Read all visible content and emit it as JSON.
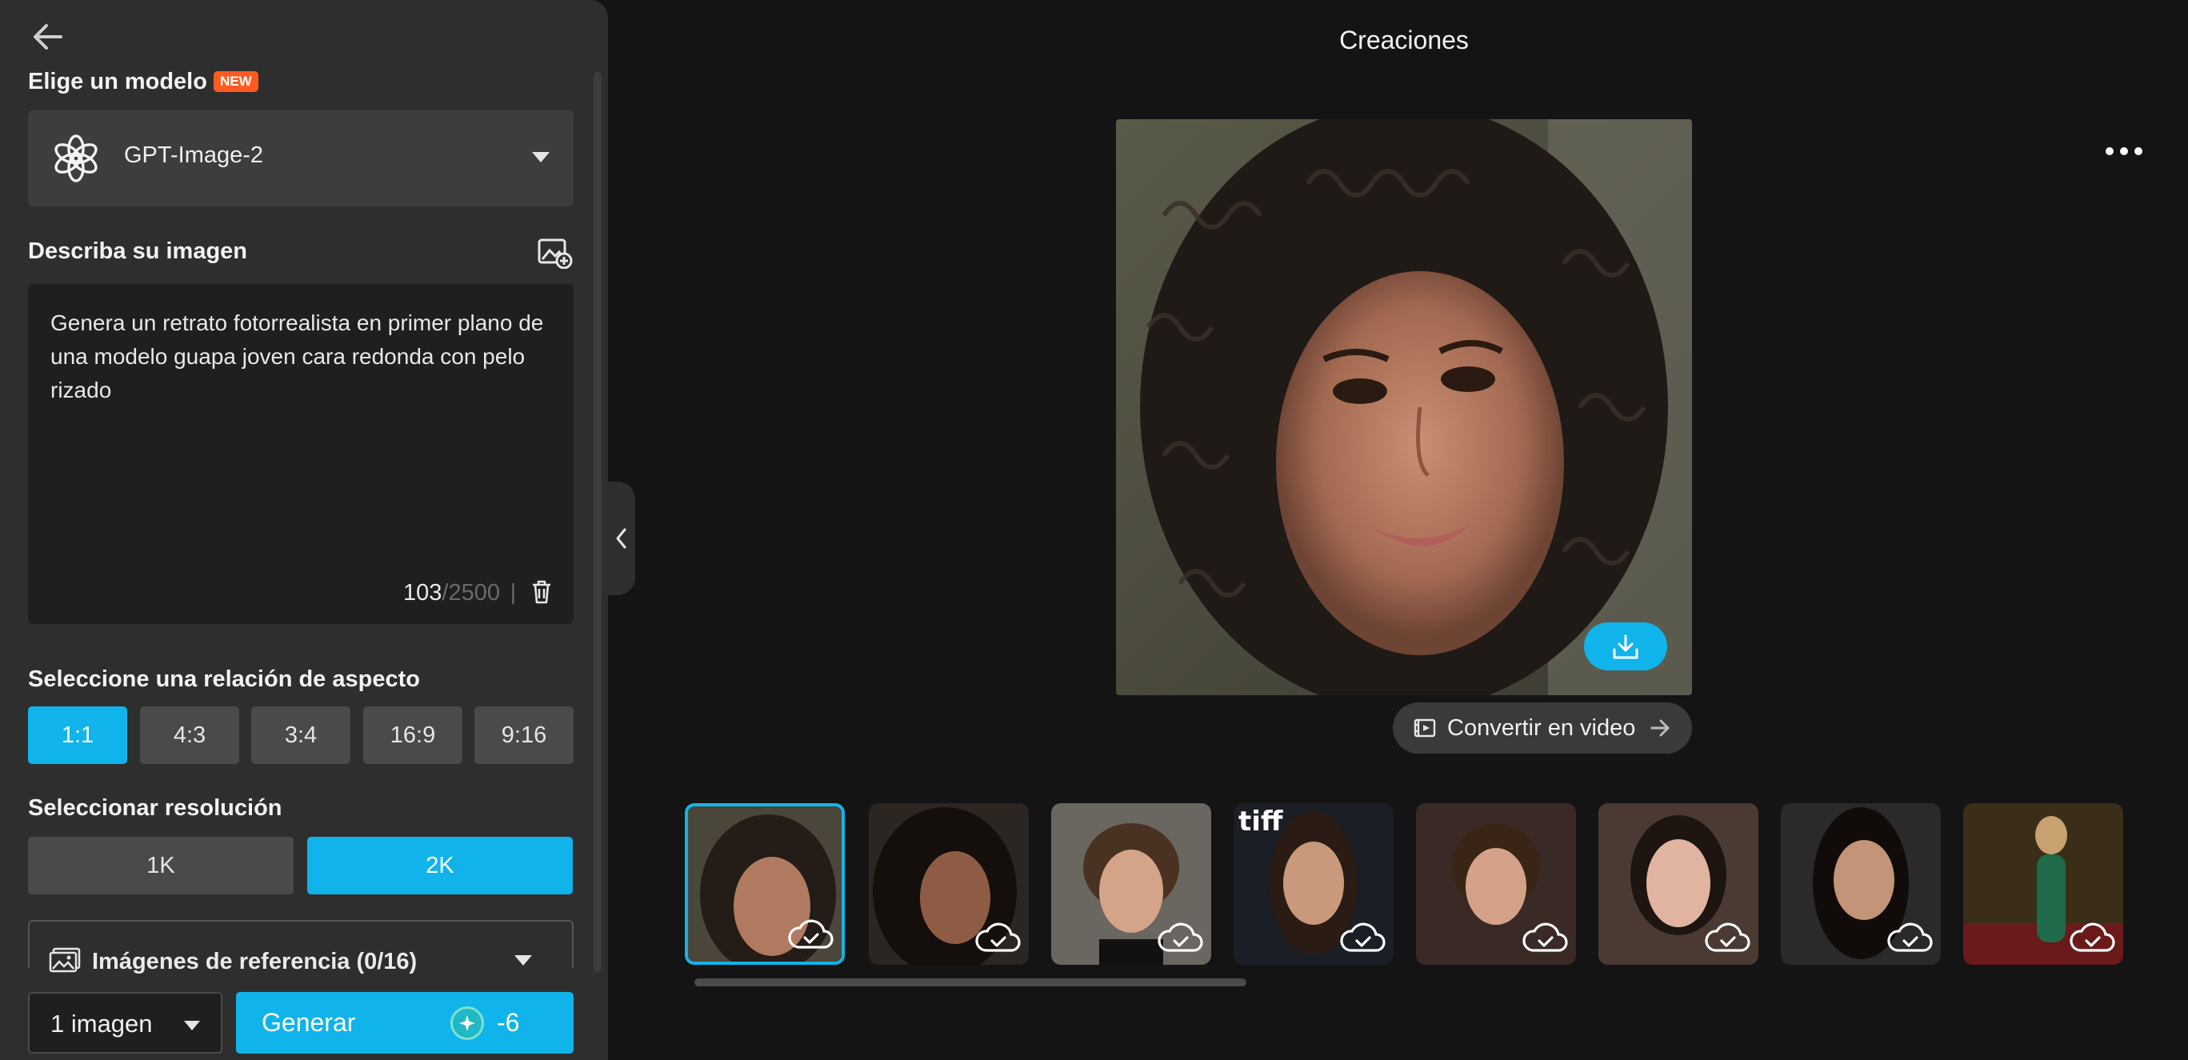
{
  "panel": {
    "model_section_title": "Elige un modelo",
    "model_badge": "NEW",
    "model_name": "GPT-Image-2",
    "prompt_section_title": "Describa su imagen",
    "prompt_text": "Genera un retrato fotorrealista en primer plano de una modelo guapa joven cara redonda con pelo rizado",
    "char_count": "103",
    "char_max": "/2500",
    "aspect_section_title": "Seleccione una relación de aspecto",
    "aspect_options": [
      "1:1",
      "4:3",
      "3:4",
      "16:9",
      "9:16"
    ],
    "aspect_selected": "1:1",
    "resolution_section_title": "Seleccionar resolución",
    "resolution_options": [
      "1K",
      "2K"
    ],
    "resolution_selected": "2K",
    "reference_label": "Imágenes de referencia (0/16)",
    "image_count": "1 imagen",
    "generate_label": "Generar",
    "generate_cost": "-6"
  },
  "main": {
    "title": "Creaciones",
    "convert_label": "Convertir en video",
    "thumbnails_count": 8,
    "selected_thumbnail": 1
  },
  "colors": {
    "accent": "#10b4ea",
    "panel_bg": "#2e2e2e",
    "page_bg": "#141414",
    "badge": "#ff5a1f"
  }
}
